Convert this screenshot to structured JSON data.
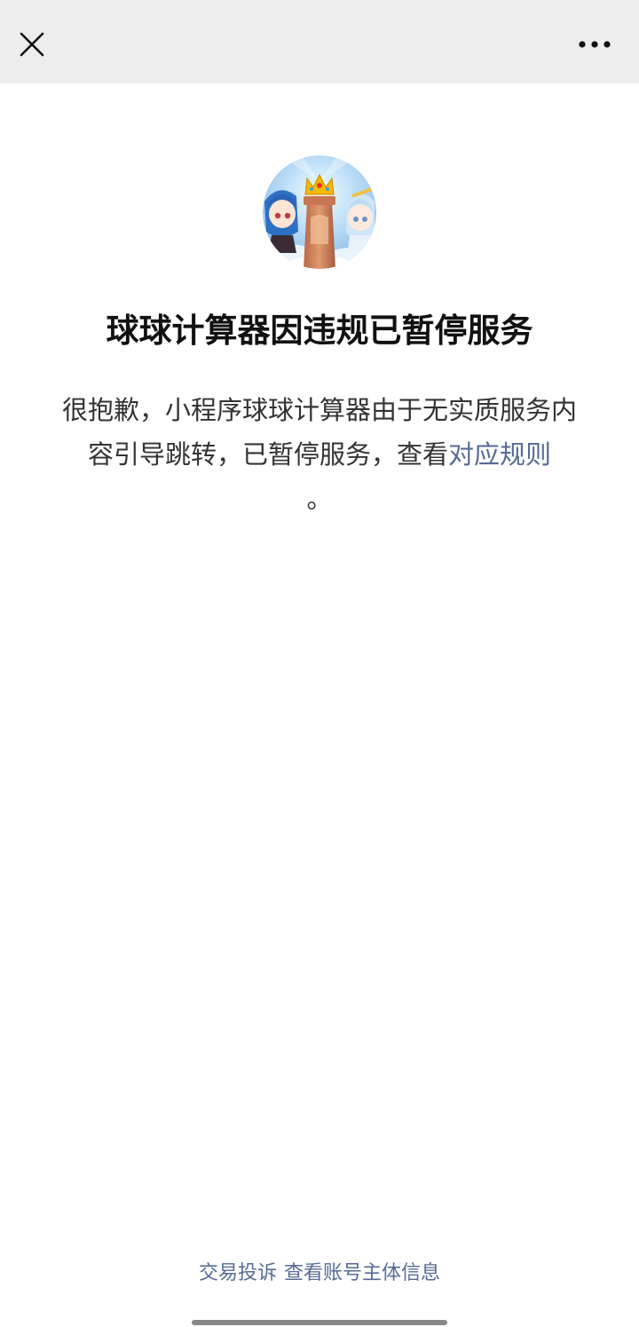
{
  "header": {
    "close_icon": "close-icon",
    "more_icon": "more-icon"
  },
  "avatar": {
    "alt": "球球计算器"
  },
  "title": "球球计算器因违规已暂停服务",
  "description": {
    "text": "很抱歉，小程序球球计算器由于无实质服务内容引导跳转，已暂停服务，查看",
    "link_label": "对应规则",
    "tail": "。"
  },
  "footer": {
    "complaint_label": "交易投诉",
    "account_info_label": "查看账号主体信息"
  },
  "colors": {
    "topbar_bg": "#ededed",
    "link": "#576b95",
    "title": "#111111",
    "body_text": "#333333"
  }
}
